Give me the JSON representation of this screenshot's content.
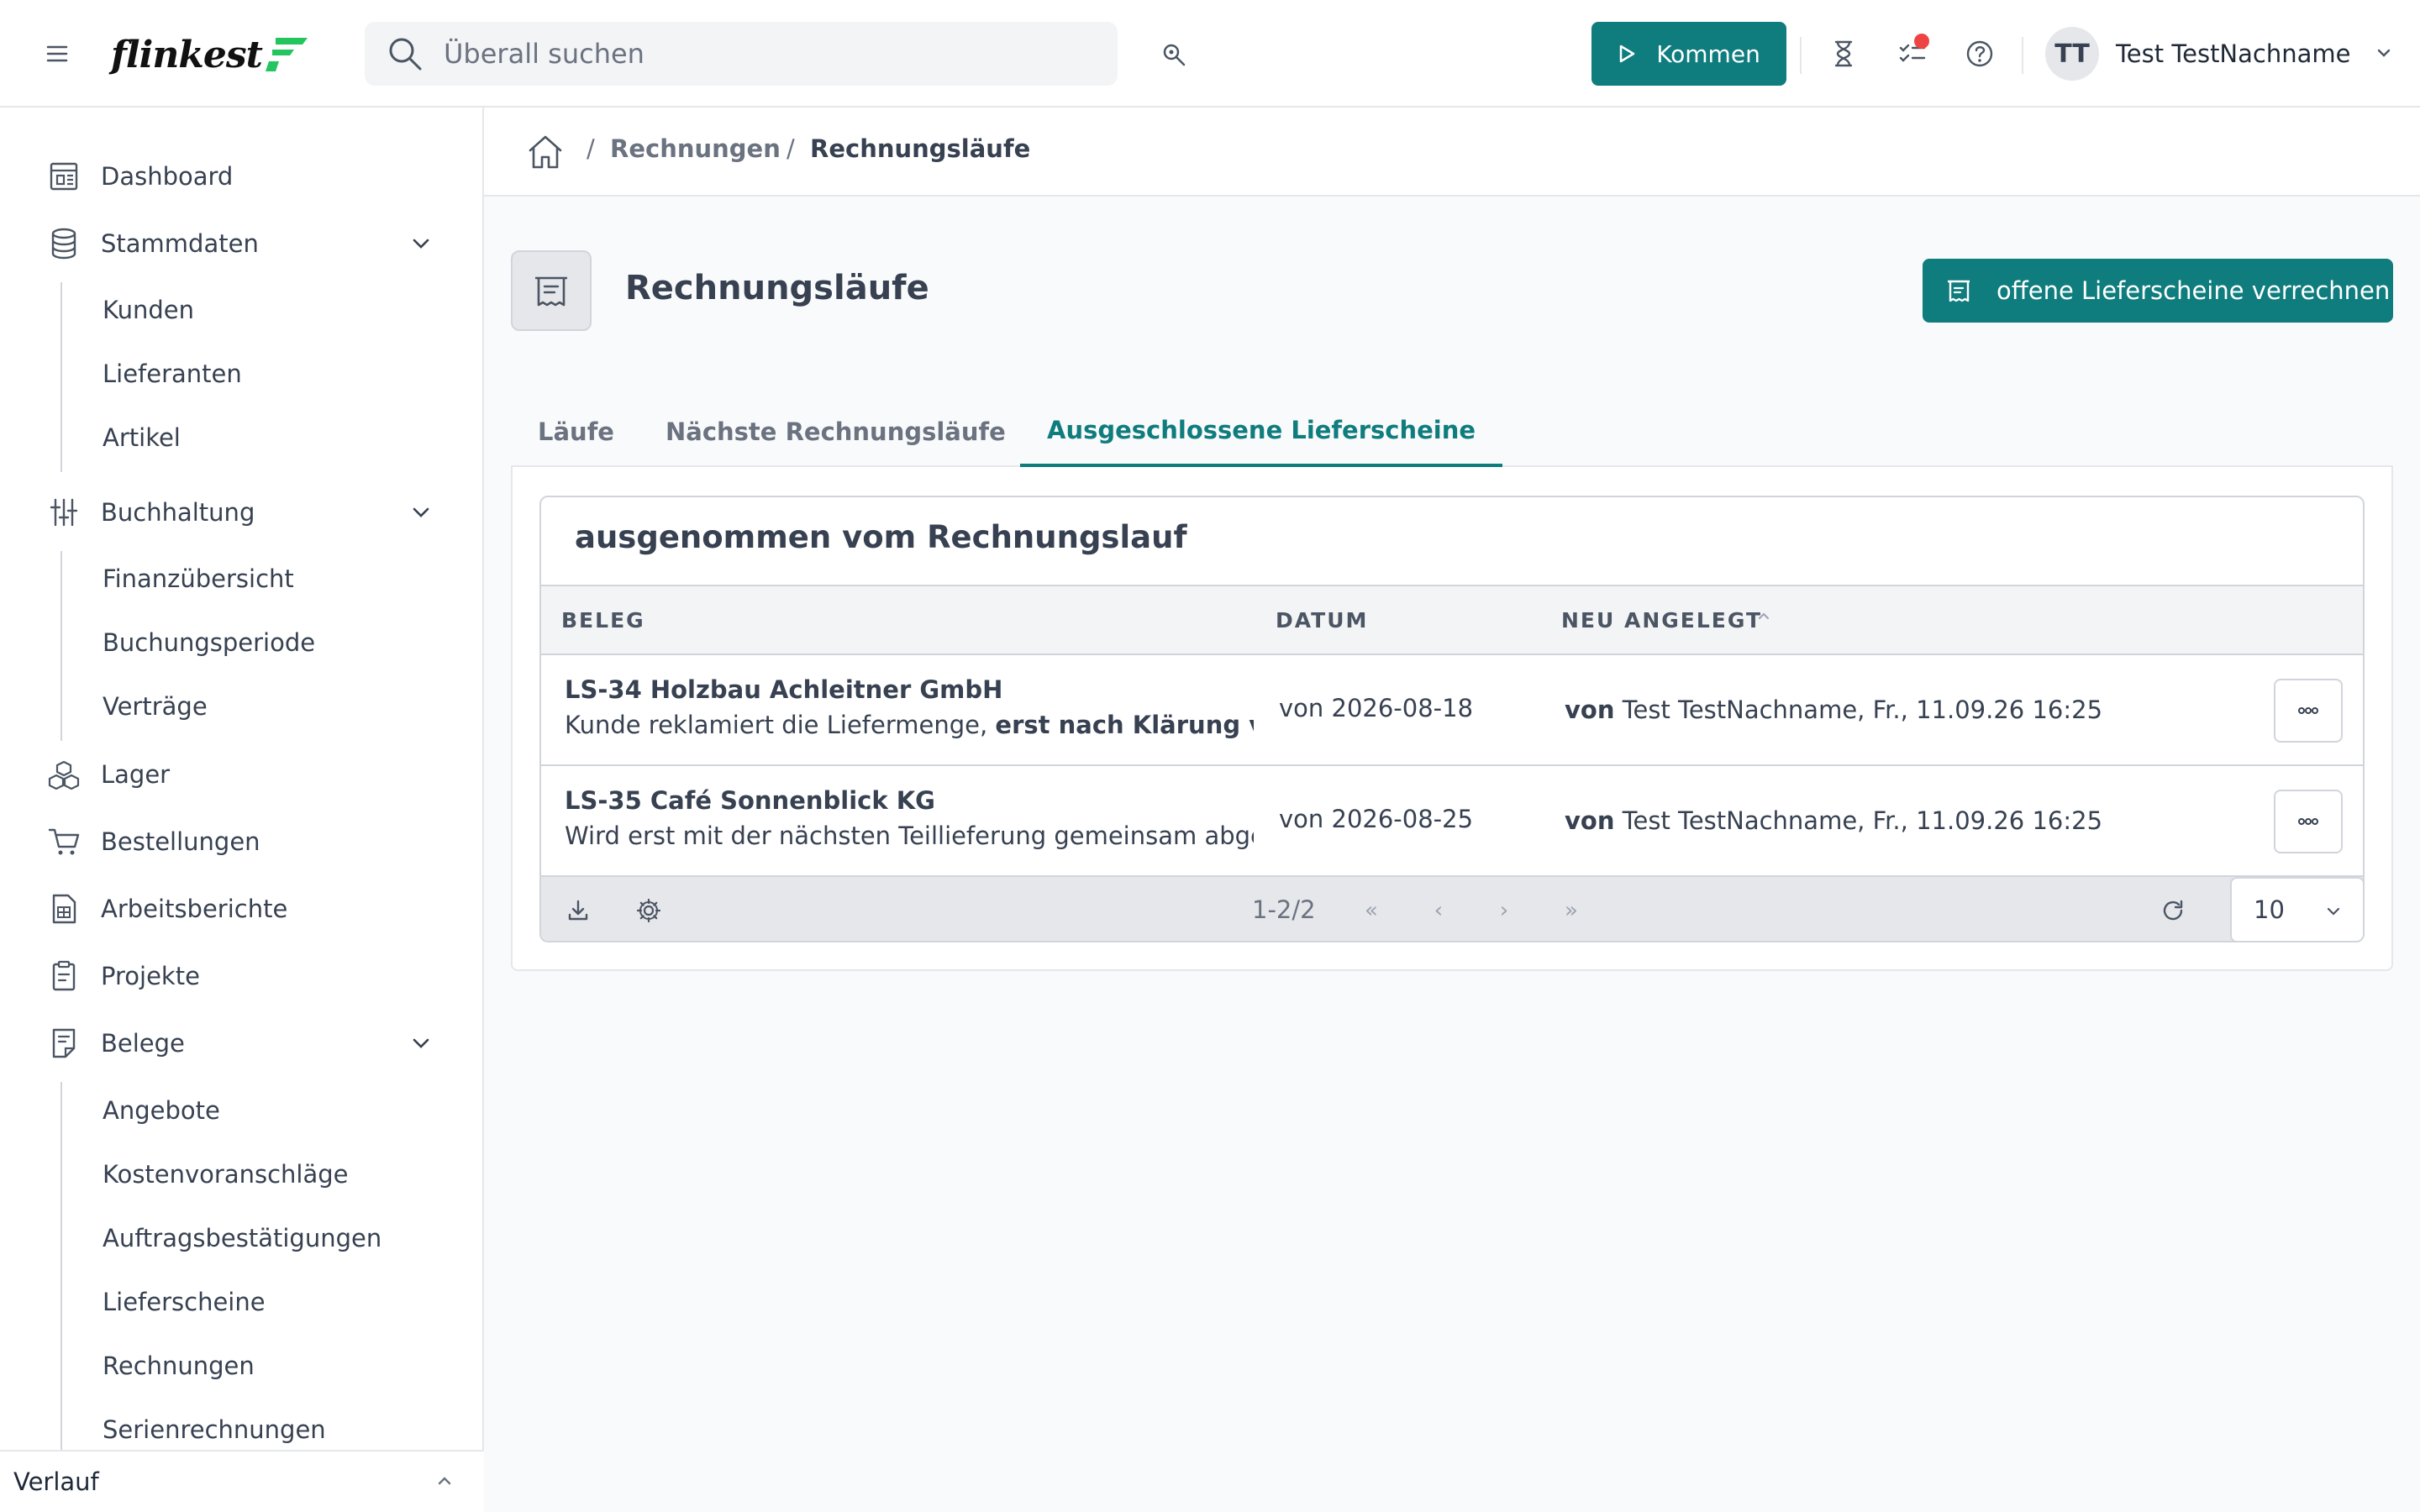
{
  "header": {
    "logo_text": "flinkest",
    "search_placeholder": "Überall suchen",
    "kommen_label": "Kommen",
    "user_initials": "TT",
    "user_name": "Test TestNachname"
  },
  "sidebar": {
    "items": [
      {
        "label": "Dashboard",
        "icon": "dashboard-icon"
      },
      {
        "label": "Stammdaten",
        "icon": "database-icon",
        "expanded": true,
        "children": [
          "Kunden",
          "Lieferanten",
          "Artikel"
        ]
      },
      {
        "label": "Buchhaltung",
        "icon": "sliders-icon",
        "expanded": true,
        "children": [
          "Finanzübersicht",
          "Buchungsperiode",
          "Verträge"
        ]
      },
      {
        "label": "Lager",
        "icon": "boxes-icon"
      },
      {
        "label": "Bestellungen",
        "icon": "cart-icon"
      },
      {
        "label": "Arbeitsberichte",
        "icon": "report-icon"
      },
      {
        "label": "Projekte",
        "icon": "clipboard-icon"
      },
      {
        "label": "Belege",
        "icon": "document-icon",
        "expanded": true,
        "children": [
          "Angebote",
          "Kostenvoranschläge",
          "Auftragsbestätigungen",
          "Lieferscheine",
          "Rechnungen",
          "Serienrechnungen"
        ]
      }
    ],
    "footer_label": "Verlauf"
  },
  "breadcrumb": {
    "items": [
      "Rechnungen",
      "Rechnungsläufe"
    ]
  },
  "page": {
    "title": "Rechnungsläufe",
    "action_button": "offene Lieferscheine verrechnen"
  },
  "tabs": [
    {
      "label": "Läufe",
      "active": false
    },
    {
      "label": "Nächste Rechnungsläufe",
      "active": false
    },
    {
      "label": "Ausgeschlossene Lieferscheine",
      "active": true
    }
  ],
  "table": {
    "title": "ausgenommen vom Rechnungslauf",
    "columns": [
      "BELEG",
      "DATUM",
      "NEU ANGELEGT"
    ],
    "sort_column": "NEU ANGELEGT",
    "sort_direction": "asc",
    "rows": [
      {
        "title": "LS-34 Holzbau Achleitner GmbH",
        "note_plain": "Kunde reklamiert die Liefermenge, ",
        "note_bold": "erst nach Klärung v",
        "date": "von 2026-08-18",
        "created_prefix": "von",
        "created_rest": " Test TestNachname, Fr., 11.09.26 16:25"
      },
      {
        "title": "LS-35 Café Sonnenblick KG",
        "note_plain": "Wird erst mit der nächsten Teillieferung gemeinsam abge",
        "note_bold": "",
        "date": "von 2026-08-25",
        "created_prefix": "von",
        "created_rest": " Test TestNachname, Fr., 11.09.26 16:25"
      }
    ],
    "pagination": {
      "info": "1-2/2",
      "first": "«",
      "prev": "‹",
      "next": "›",
      "last": "»",
      "per_page": "10"
    }
  },
  "colors": {
    "accent": "#0f7c7e",
    "notification": "#ef4444",
    "logo_green": "#22c55e"
  }
}
